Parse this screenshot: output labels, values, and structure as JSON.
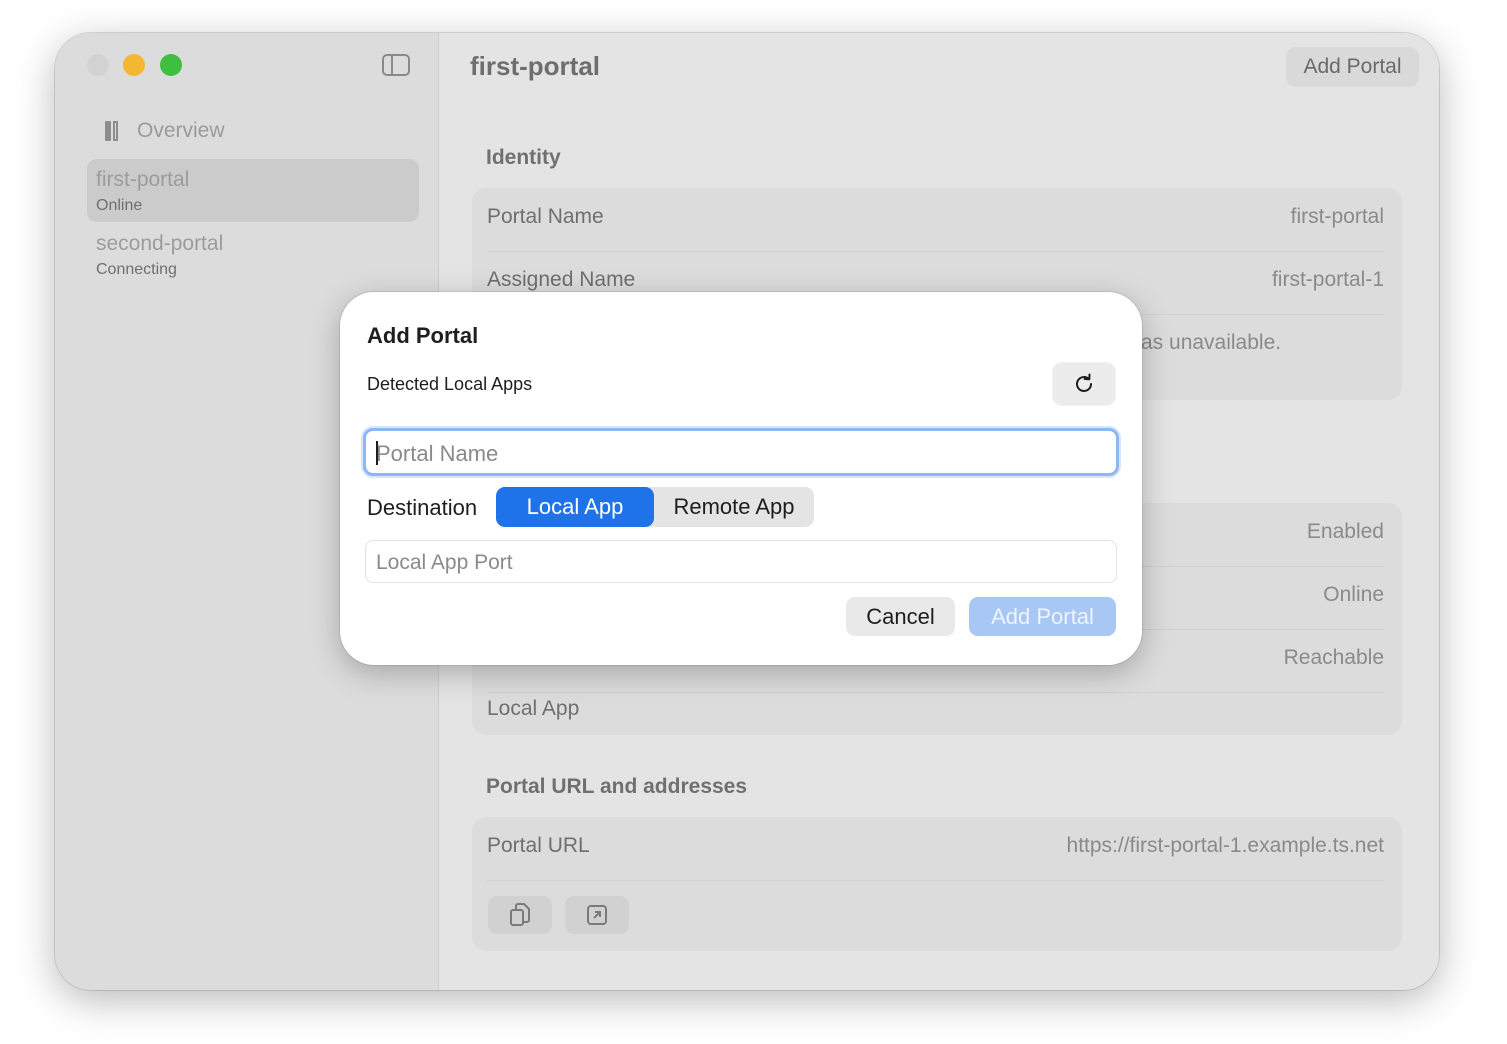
{
  "sidebar": {
    "overview_label": "Overview",
    "items": [
      {
        "name": "first-portal",
        "status": "Online"
      },
      {
        "name": "second-portal",
        "status": "Connecting"
      }
    ]
  },
  "main": {
    "title": "first-portal",
    "add_button": "Add Portal",
    "identity": {
      "heading": "Identity",
      "rows": [
        {
          "label": "Portal Name",
          "value": "first-portal"
        },
        {
          "label": "Assigned Name",
          "value": "first-portal-1"
        }
      ],
      "note_fragment": "as unavailable."
    },
    "status_values": [
      "Enabled",
      "Online",
      "Reachable"
    ],
    "destination_label": "Local App",
    "urls": {
      "heading": "Portal URL and addresses",
      "row": {
        "label": "Portal URL",
        "value": "https://first-portal-1.example.ts.net"
      }
    }
  },
  "dialog": {
    "title": "Add Portal",
    "detected_label": "Detected Local Apps",
    "portal_name_placeholder": "Portal Name",
    "destination_label": "Destination",
    "destination_options": [
      "Local App",
      "Remote App"
    ],
    "selected_destination": "Local App",
    "local_port_placeholder": "Local App Port",
    "cancel_label": "Cancel",
    "add_label": "Add Portal"
  },
  "colors": {
    "accent": "#1f73e8",
    "focus_ring": "#8cb6f4",
    "disabled_button": "#a9c7f5",
    "close": "#d2d2d2",
    "minimize": "#f3b731",
    "maximize": "#3fbf3f"
  }
}
